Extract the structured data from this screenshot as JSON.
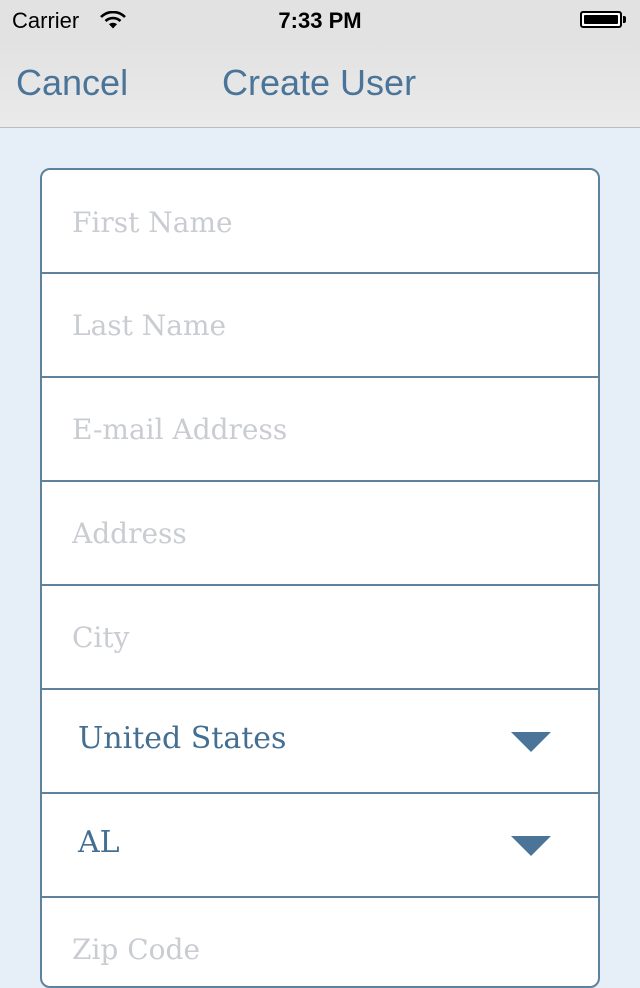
{
  "status_bar": {
    "carrier": "Carrier",
    "time": "7:33 PM",
    "wifi_icon": "wifi-icon",
    "battery_icon": "battery-icon"
  },
  "nav": {
    "cancel_label": "Cancel",
    "title": "Create User"
  },
  "form": {
    "first_name": {
      "placeholder": "First Name",
      "value": ""
    },
    "last_name": {
      "placeholder": "Last Name",
      "value": ""
    },
    "email": {
      "placeholder": "E-mail Address",
      "value": ""
    },
    "address": {
      "placeholder": "Address",
      "value": ""
    },
    "city": {
      "placeholder": "City",
      "value": ""
    },
    "country": {
      "selected": "United States",
      "icon": "caret-down-icon"
    },
    "state": {
      "selected": "AL",
      "icon": "caret-down-icon"
    },
    "zip": {
      "placeholder": "Zip Code",
      "value": ""
    }
  },
  "colors": {
    "accent": "#4a7598",
    "background": "#e6eef8",
    "border": "#5f819c",
    "placeholder": "#c9ccd1"
  }
}
